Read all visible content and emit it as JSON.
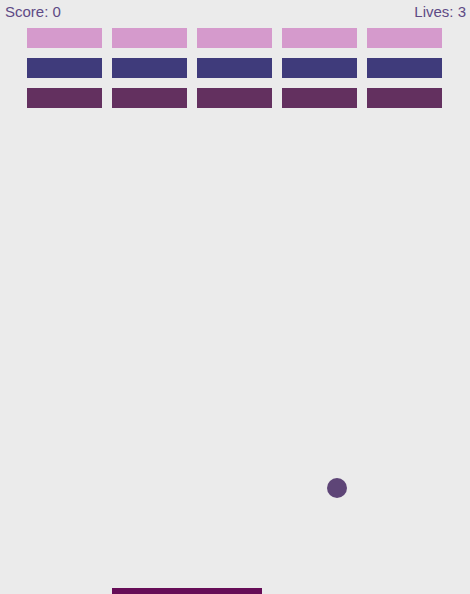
{
  "hud": {
    "score": "Score: 0",
    "lives": "Lives: 3"
  },
  "brick_rows": [
    {
      "color": "#d59acc",
      "bricks": [
        {
          "intact": true
        },
        {
          "intact": true
        },
        {
          "intact": true
        },
        {
          "intact": true
        },
        {
          "intact": true
        }
      ]
    },
    {
      "color": "#3f3b7b",
      "bricks": [
        {
          "intact": true
        },
        {
          "intact": true
        },
        {
          "intact": true
        },
        {
          "intact": true
        },
        {
          "intact": true
        }
      ]
    },
    {
      "color": "#63305f",
      "bricks": [
        {
          "intact": true
        },
        {
          "intact": true
        },
        {
          "intact": true
        },
        {
          "intact": true
        },
        {
          "intact": true
        }
      ]
    }
  ]
}
